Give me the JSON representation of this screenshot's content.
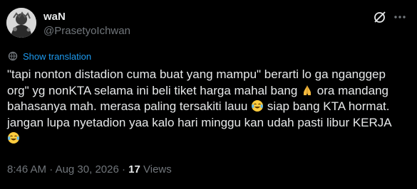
{
  "author": {
    "display_name": "waN",
    "handle": "@PrasetyoIchwan"
  },
  "translate": {
    "label": "Show translation"
  },
  "tweet": {
    "line1": "\"tapi nonton distadion cuma buat yang mampu\" berarti lo ga nganggep",
    "line2a": "org\" yg nonKTA selama ini beli tiket harga mahal bang ",
    "line2b": " ora mandang",
    "line3a": "bahasanya mah. merasa paling tersakiti lauu ",
    "line3b": " siap bang KTA hormat.",
    "line4": "jangan lupa nyetadion yaa kalo hari minggu kan udah pasti libur KERJA",
    "emojis": [
      "folded-hands-emoji",
      "tears-of-joy-emoji",
      "tears-of-joy-emoji"
    ]
  },
  "meta": {
    "time": "8:46 AM",
    "separator1": " · ",
    "date": "Aug 30, 2026",
    "separator2": " · ",
    "views_count": "17",
    "views_label": " Views"
  },
  "colors": {
    "background": "#000000",
    "text": "#e7e9ea",
    "muted": "#71767b",
    "link": "#1d9bf0"
  },
  "icons": [
    "grok-icon",
    "more-icon",
    "translate-icon"
  ]
}
